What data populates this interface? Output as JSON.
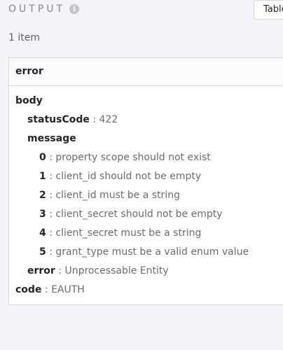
{
  "header": {
    "title": "OUTPUT",
    "info_icon": "info-icon",
    "view_toggle_label": "Table"
  },
  "item_count": "1 item",
  "card": {
    "title": "error",
    "body": {
      "label": "body",
      "statusCode": {
        "key": "statusCode",
        "value": "422"
      },
      "message": {
        "label": "message",
        "items": [
          {
            "key": "0",
            "value": "property scope should not exist"
          },
          {
            "key": "1",
            "value": "client_id should not be empty"
          },
          {
            "key": "2",
            "value": "client_id must be a string"
          },
          {
            "key": "3",
            "value": "client_secret should not be empty"
          },
          {
            "key": "4",
            "value": "client_secret must be a string"
          },
          {
            "key": "5",
            "value": "grant_type must be a valid enum value"
          }
        ]
      },
      "error": {
        "key": "error",
        "value": "Unprocessable Entity"
      }
    },
    "code": {
      "key": "code",
      "value": "EAUTH"
    }
  },
  "separator": ":"
}
